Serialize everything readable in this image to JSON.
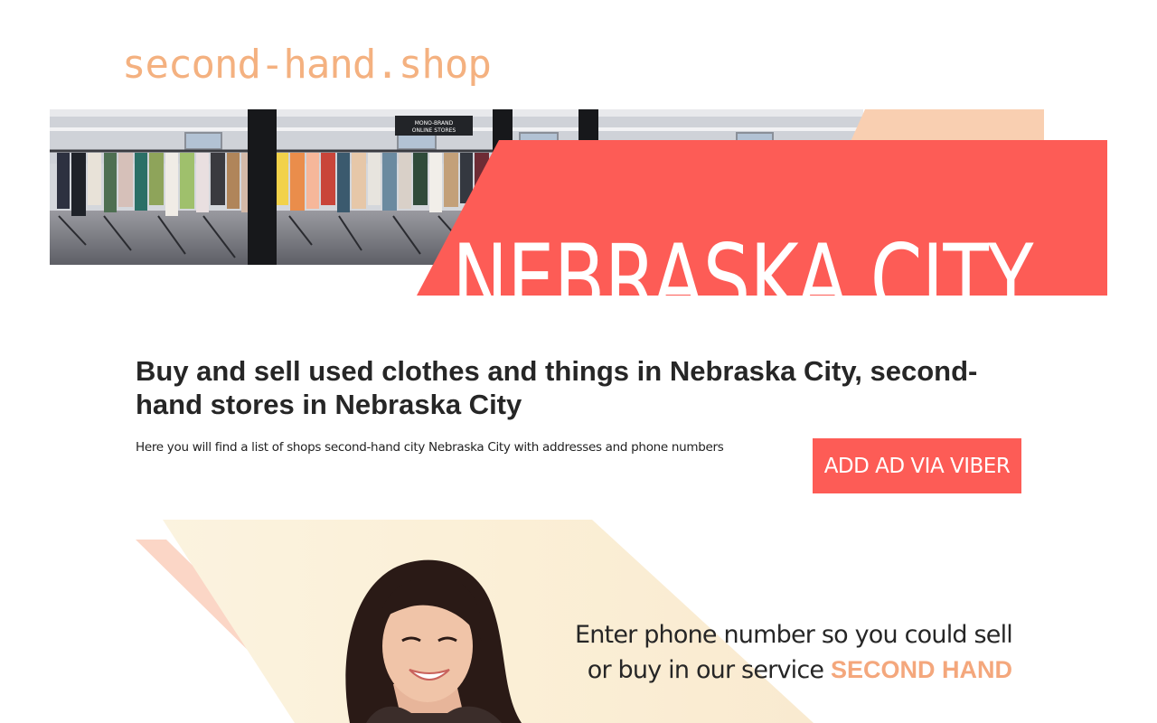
{
  "site": {
    "logo": "second-hand.shop"
  },
  "hero": {
    "city_title": "NEBRASKA CITY",
    "store_sign": "MONO-BRAND\nONLINE STORES"
  },
  "main": {
    "headline": "Buy and sell used clothes and things in Nebraska City, second-hand stores in Nebraska City",
    "lead": "Here you will find a list of shops second-hand city Nebraska City with addresses and phone numbers",
    "viber_button": "ADD AD VIA VIBER"
  },
  "promo": {
    "text": "Enter phone number so you could sell or buy in our service",
    "brand": "SECOND HAND"
  },
  "colors": {
    "accent": "#fd5c56",
    "logo": "#f4b180",
    "peach": "#f9cfb1",
    "brand_text": "#f4a77c"
  }
}
